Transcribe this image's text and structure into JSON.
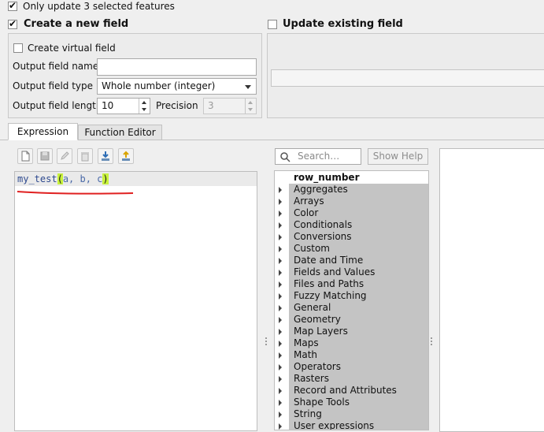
{
  "top": {
    "only_selected_label": "Only update 3 selected features",
    "only_selected_checked": true
  },
  "create": {
    "label": "Create a new field",
    "checked": true
  },
  "update": {
    "label": "Update existing field",
    "checked": false
  },
  "form": {
    "virtual_label": "Create virtual field",
    "virtual_checked": false,
    "name_label": "Output field name",
    "name_value": "",
    "type_label": "Output field type",
    "type_value": "Whole number (integer)",
    "length_label": "Output field length",
    "length_value": "10",
    "precision_label": "Precision",
    "precision_value": "3"
  },
  "tabs": [
    {
      "label": "Expression"
    },
    {
      "label": "Function Editor"
    }
  ],
  "expression": {
    "fn": "my_test",
    "open": "(",
    "args": "a, b, c",
    "close": ")"
  },
  "search": {
    "placeholder": "Search…"
  },
  "show_help_label": "Show Help",
  "tree": {
    "first": "row_number",
    "groups": [
      "Aggregates",
      "Arrays",
      "Color",
      "Conditionals",
      "Conversions",
      "Custom",
      "Date and Time",
      "Fields and Values",
      "Files and Paths",
      "Fuzzy Matching",
      "General",
      "Geometry",
      "Map Layers",
      "Maps",
      "Math",
      "Operators",
      "Rasters",
      "Record and Attributes",
      "Shape Tools",
      "String",
      "User expressions"
    ]
  }
}
